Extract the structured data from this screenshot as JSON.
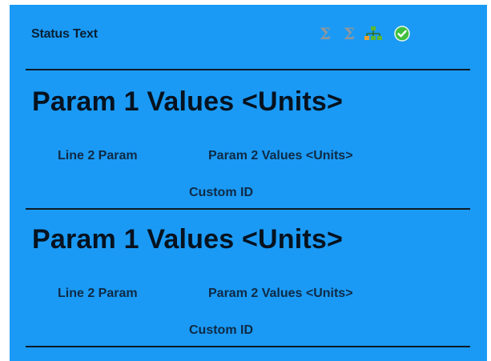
{
  "header": {
    "status_text": "Status Text",
    "icons": [
      "sigma-icon",
      "sigma-icon",
      "hierarchy-icon",
      "checkmark-circle-icon"
    ]
  },
  "records": [
    {
      "param1_value": "Param 1 Values <Units>",
      "line2_label": "Line 2 Param",
      "param2_value": "Param 2 Values <Units>",
      "custom_id": "Custom ID"
    },
    {
      "param1_value": "Param 1 Values <Units>",
      "line2_label": "Line 2 Param",
      "param2_value": "Param 2 Values <Units>",
      "custom_id": "Custom ID"
    }
  ],
  "colors": {
    "panel_background": "#1a9af5",
    "text_dark": "#06121f",
    "sigma_gray": "#8f969c",
    "hierarchy_green": "#5cb82e",
    "hierarchy_orange": "#f0a030",
    "check_green": "#3fbf3f"
  }
}
